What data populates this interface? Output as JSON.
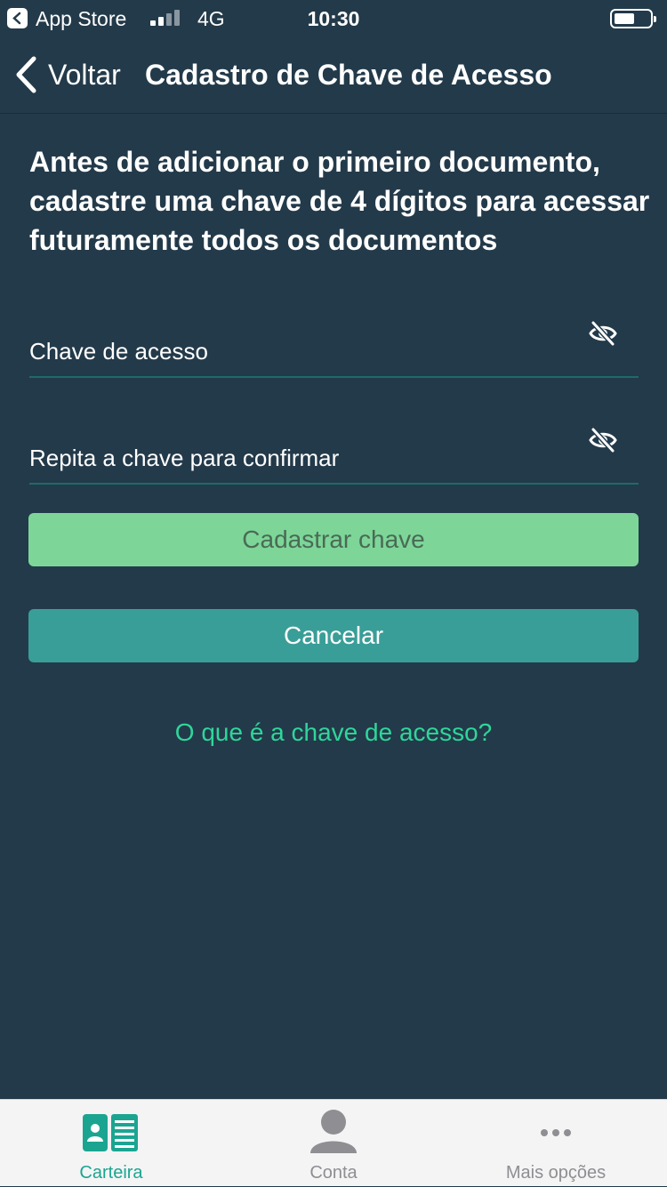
{
  "status_bar": {
    "app_store_label": "App Store",
    "network": "4G",
    "time": "10:30"
  },
  "nav": {
    "back_label": "Voltar",
    "title": "Cadastro de Chave de Acesso"
  },
  "intro_text": "Antes de adicionar o primeiro documento, cadastre uma chave de 4 dígitos para acessar futuramente todos os documentos",
  "fields": [
    {
      "label": "Chave de acesso",
      "icon": "eye-slash-icon"
    },
    {
      "label": "Repita a chave para confirmar",
      "icon": "eye-slash-icon"
    }
  ],
  "buttons": {
    "submit_label": "Cadastrar chave",
    "cancel_label": "Cancelar"
  },
  "help_link": "O que é a chave de acesso?",
  "tabs": [
    {
      "label": "Carteira",
      "icon": "wallet-card-icon",
      "active": true
    },
    {
      "label": "Conta",
      "icon": "user-icon",
      "active": false
    },
    {
      "label": "Mais opções",
      "icon": "more-dots-icon",
      "active": false
    }
  ],
  "colors": {
    "background": "#233a4a",
    "accent": "#1ba591",
    "submit_button": "#7dd698",
    "cancel_button": "#3a9e98",
    "link": "#2fd69a"
  }
}
